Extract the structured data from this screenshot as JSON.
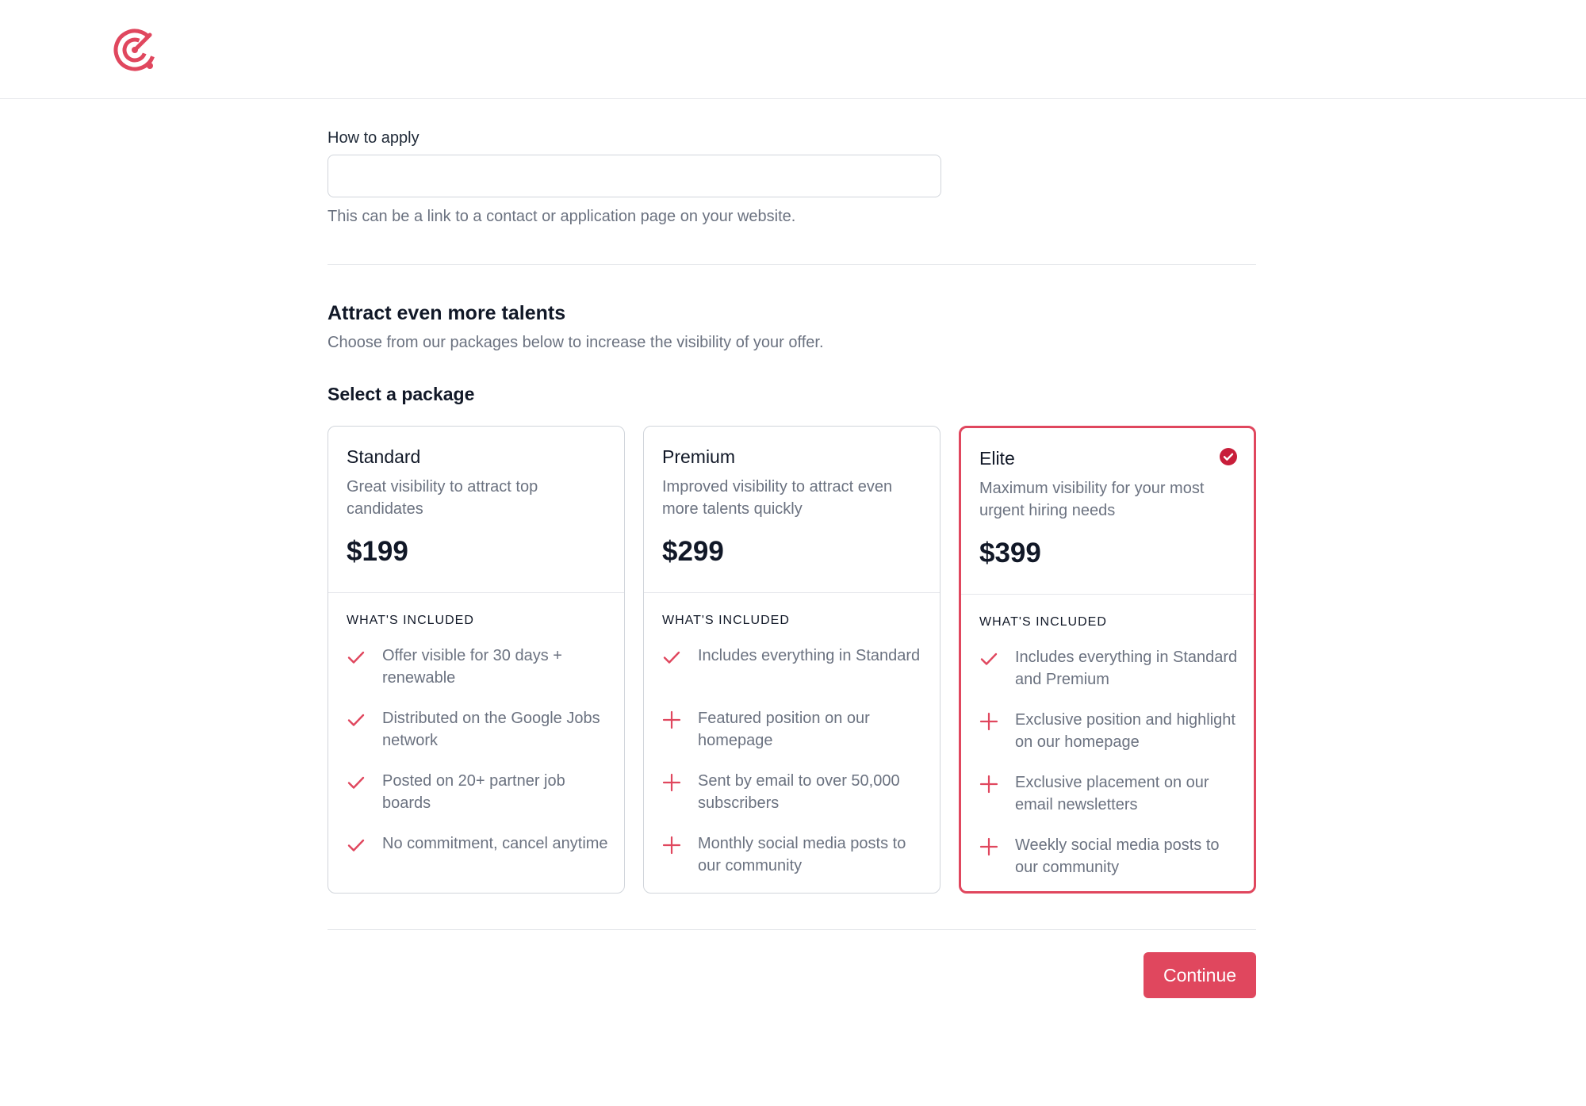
{
  "colors": {
    "accent": "#e0475e",
    "text_dark": "#111827",
    "text_muted": "#6b7280",
    "border": "#d1d5db"
  },
  "header": {
    "logo_icon": "radar-target-logo-icon"
  },
  "apply": {
    "label": "How to apply",
    "value": "",
    "placeholder": "",
    "help": "This can be a link to a contact or application page on your website."
  },
  "packages_section": {
    "title": "Attract even more talents",
    "subtitle": "Choose from our packages below to increase the visibility of your offer.",
    "select_label": "Select a package",
    "included_label": "WHAT'S INCLUDED"
  },
  "packages": [
    {
      "name": "Standard",
      "description": "Great visibility to attract top candidates",
      "price": "$199",
      "selected": false,
      "features": [
        {
          "icon": "check-icon",
          "text": "Offer visible for 30 days + renewable"
        },
        {
          "icon": "check-icon",
          "text": "Distributed on the Google Jobs network"
        },
        {
          "icon": "check-icon",
          "text": "Posted on 20+ partner job boards"
        },
        {
          "icon": "check-icon",
          "text": "No commitment, cancel anytime"
        }
      ]
    },
    {
      "name": "Premium",
      "description": "Improved visibility to attract even more talents quickly",
      "price": "$299",
      "selected": false,
      "features": [
        {
          "icon": "check-icon",
          "text": "Includes everything in Standard"
        },
        {
          "icon": "plus-icon",
          "text": "Featured position on our homepage"
        },
        {
          "icon": "plus-icon",
          "text": "Sent by email to over 50,000 subscribers"
        },
        {
          "icon": "plus-icon",
          "text": "Monthly social media posts to our community"
        }
      ]
    },
    {
      "name": "Elite",
      "description": "Maximum visibility for your most urgent hiring needs",
      "price": "$399",
      "selected": true,
      "features": [
        {
          "icon": "check-icon",
          "text": "Includes everything in Standard and Premium"
        },
        {
          "icon": "plus-icon",
          "text": "Exclusive position and highlight on our homepage"
        },
        {
          "icon": "plus-icon",
          "text": "Exclusive placement on our email newsletters"
        },
        {
          "icon": "plus-icon",
          "text": "Weekly social media posts to our community"
        }
      ]
    }
  ],
  "footer": {
    "continue_label": "Continue"
  }
}
